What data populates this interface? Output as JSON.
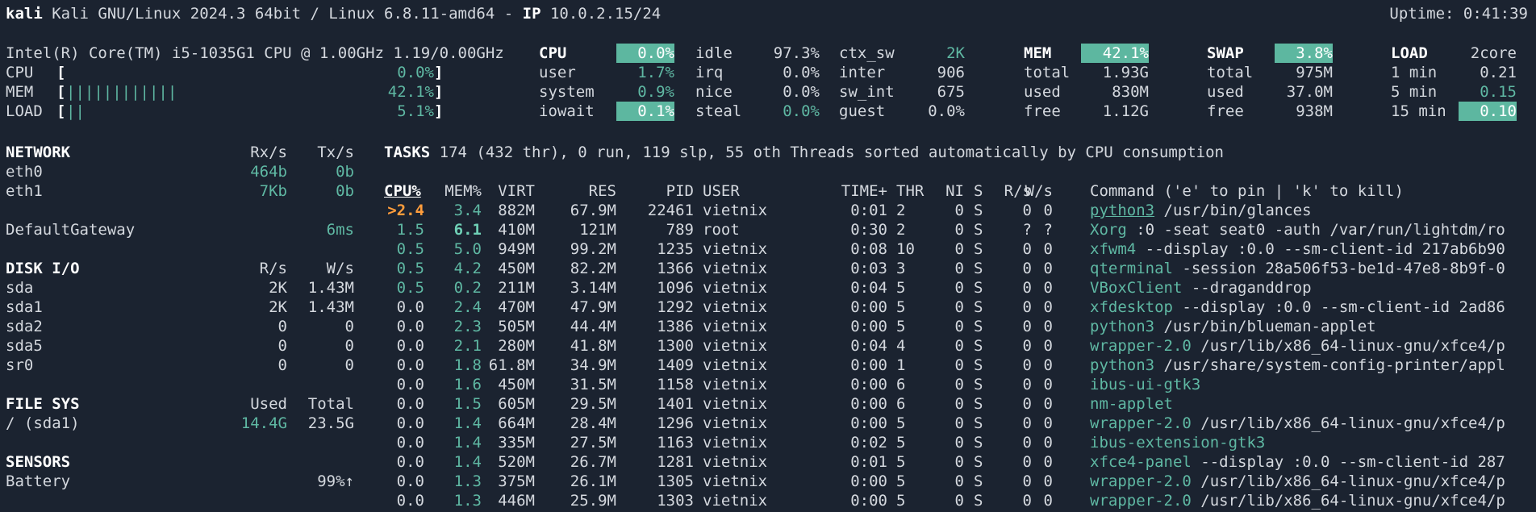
{
  "header": {
    "hostname": "kali",
    "os": "Kali GNU/Linux 2024.3 64bit / Linux 6.8.11-amd64 -",
    "ip_label": "IP",
    "ip": "10.0.2.15/24",
    "uptime": "Uptime: 0:41:39"
  },
  "quicklook": {
    "cpu_name": "Intel(R) Core(TM) i5-1035G1 CPU @ 1.00GHz 1.19/0.00GHz",
    "rows": [
      {
        "label": "CPU",
        "open": "[",
        "bar": "",
        "value": "0.0%",
        "close": "]"
      },
      {
        "label": "MEM",
        "open": "[",
        "bar": "||||||||||||",
        "value": "42.1%",
        "close": "]"
      },
      {
        "label": "LOAD",
        "open": "[",
        "bar": "||",
        "value": "5.1%",
        "close": "]"
      }
    ]
  },
  "cpu": {
    "title": "CPU",
    "total": "0.0%",
    "col1": [
      {
        "k": "user",
        "v": "1.7%"
      },
      {
        "k": "system",
        "v": "0.9%"
      },
      {
        "k": "iowait",
        "v": "0.1%"
      }
    ],
    "col2": [
      {
        "k": "idle",
        "v": "97.3%"
      },
      {
        "k": "irq",
        "v": "0.0%"
      },
      {
        "k": "nice",
        "v": "0.0%"
      },
      {
        "k": "steal",
        "v": "0.0%"
      }
    ],
    "col3": [
      {
        "k": "ctx_sw",
        "v": "2K"
      },
      {
        "k": "inter",
        "v": "906"
      },
      {
        "k": "sw_int",
        "v": "675"
      },
      {
        "k": "guest",
        "v": "0.0%"
      }
    ]
  },
  "mem": {
    "title": "MEM",
    "percent": "42.1%",
    "rows": [
      {
        "k": "total",
        "v": "1.93G"
      },
      {
        "k": "used",
        "v": "830M"
      },
      {
        "k": "free",
        "v": "1.12G"
      }
    ]
  },
  "swap": {
    "title": "SWAP",
    "percent": "3.8%",
    "rows": [
      {
        "k": "total",
        "v": "975M"
      },
      {
        "k": "used",
        "v": "37.0M"
      },
      {
        "k": "free",
        "v": "938M"
      }
    ]
  },
  "load": {
    "title": "LOAD",
    "cores": "2core",
    "rows": [
      {
        "k": "1 min",
        "v": "0.21"
      },
      {
        "k": "5 min",
        "v": "0.15"
      },
      {
        "k": "15 min",
        "v": "0.10"
      }
    ]
  },
  "network": {
    "title": "NETWORK",
    "rx": "Rx/s",
    "tx": "Tx/s",
    "rows": [
      {
        "name": "eth0",
        "rx": "464b",
        "tx": "0b"
      },
      {
        "name": "eth1",
        "rx": "7Kb",
        "tx": "0b"
      }
    ],
    "gateway_label": "DefaultGateway",
    "gateway_value": "6ms"
  },
  "disk": {
    "title": "DISK I/O",
    "r": "R/s",
    "w": "W/s",
    "rows": [
      {
        "name": "sda",
        "r": "2K",
        "w": "1.43M"
      },
      {
        "name": "sda1",
        "r": "2K",
        "w": "1.43M"
      },
      {
        "name": "sda2",
        "r": "0",
        "w": "0"
      },
      {
        "name": "sda5",
        "r": "0",
        "w": "0"
      },
      {
        "name": "sr0",
        "r": "0",
        "w": "0"
      }
    ]
  },
  "fs": {
    "title": "FILE SYS",
    "used": "Used",
    "total": "Total",
    "rows": [
      {
        "name": "/ (sda1)",
        "used": "14.4G",
        "total": "23.5G"
      }
    ]
  },
  "sensors": {
    "title": "SENSORS",
    "rows": [
      {
        "name": "Battery",
        "value": "99%↑"
      }
    ]
  },
  "tasks": {
    "title": "TASKS",
    "summary": "174 (432 thr), 0 run, 119 slp, 55 oth Threads sorted automatically by CPU consumption"
  },
  "proc_headers": {
    "cpu": "CPU%",
    "mem": "MEM%",
    "virt": "VIRT",
    "res": "RES",
    "pid": "PID",
    "user": "USER",
    "time": "TIME+",
    "thr": "THR",
    "ni": "NI",
    "s": "S",
    "rs": "R/s",
    "ws": "W/s",
    "cmd": "Command ('e' to pin | 'k' to kill)"
  },
  "processes": [
    {
      "cpu": ">2.4",
      "mem": "3.4",
      "virt": "882M",
      "res": "67.9M",
      "pid": "22461",
      "user": "vietnix",
      "time": "0:01",
      "thr": "2",
      "ni": "0",
      "s": "S",
      "rs": "0",
      "ws": "0",
      "prog": "python3",
      "args": " /usr/bin/glances"
    },
    {
      "cpu": "1.5",
      "mem": "6.1",
      "virt": "410M",
      "res": "121M",
      "pid": "789",
      "user": "root",
      "time": "0:30",
      "thr": "2",
      "ni": "0",
      "s": "S",
      "rs": "?",
      "ws": "?",
      "prog": "Xorg",
      "args": " :0 -seat seat0 -auth /var/run/lightdm/ro"
    },
    {
      "cpu": "0.5",
      "mem": "5.0",
      "virt": "949M",
      "res": "99.2M",
      "pid": "1235",
      "user": "vietnix",
      "time": "0:08",
      "thr": "10",
      "ni": "0",
      "s": "S",
      "rs": "0",
      "ws": "0",
      "prog": "xfwm4",
      "args": " --display :0.0 --sm-client-id 217ab6b90"
    },
    {
      "cpu": "0.5",
      "mem": "4.2",
      "virt": "450M",
      "res": "82.2M",
      "pid": "1366",
      "user": "vietnix",
      "time": "0:03",
      "thr": "3",
      "ni": "0",
      "s": "S",
      "rs": "0",
      "ws": "0",
      "prog": "qterminal",
      "args": " -session 28a506f53-be1d-47e8-8b9f-0"
    },
    {
      "cpu": "0.5",
      "mem": "0.2",
      "virt": "211M",
      "res": "3.14M",
      "pid": "1096",
      "user": "vietnix",
      "time": "0:04",
      "thr": "5",
      "ni": "0",
      "s": "S",
      "rs": "0",
      "ws": "0",
      "prog": "VBoxClient",
      "args": " --draganddrop"
    },
    {
      "cpu": "0.0",
      "mem": "2.4",
      "virt": "470M",
      "res": "47.9M",
      "pid": "1292",
      "user": "vietnix",
      "time": "0:00",
      "thr": "5",
      "ni": "0",
      "s": "S",
      "rs": "0",
      "ws": "0",
      "prog": "xfdesktop",
      "args": " --display :0.0 --sm-client-id 2ad86"
    },
    {
      "cpu": "0.0",
      "mem": "2.3",
      "virt": "505M",
      "res": "44.4M",
      "pid": "1386",
      "user": "vietnix",
      "time": "0:00",
      "thr": "5",
      "ni": "0",
      "s": "S",
      "rs": "0",
      "ws": "0",
      "prog": "python3",
      "args": " /usr/bin/blueman-applet"
    },
    {
      "cpu": "0.0",
      "mem": "2.1",
      "virt": "280M",
      "res": "41.8M",
      "pid": "1300",
      "user": "vietnix",
      "time": "0:04",
      "thr": "4",
      "ni": "0",
      "s": "S",
      "rs": "0",
      "ws": "0",
      "prog": "wrapper-2.0",
      "args": " /usr/lib/x86_64-linux-gnu/xfce4/p"
    },
    {
      "cpu": "0.0",
      "mem": "1.8",
      "virt": "61.8M",
      "res": "34.9M",
      "pid": "1409",
      "user": "vietnix",
      "time": "0:00",
      "thr": "1",
      "ni": "0",
      "s": "S",
      "rs": "0",
      "ws": "0",
      "prog": "python3",
      "args": " /usr/share/system-config-printer/appl"
    },
    {
      "cpu": "0.0",
      "mem": "1.6",
      "virt": "450M",
      "res": "31.5M",
      "pid": "1158",
      "user": "vietnix",
      "time": "0:00",
      "thr": "6",
      "ni": "0",
      "s": "S",
      "rs": "0",
      "ws": "0",
      "prog": "ibus-ui-gtk3",
      "args": ""
    },
    {
      "cpu": "0.0",
      "mem": "1.5",
      "virt": "605M",
      "res": "29.5M",
      "pid": "1401",
      "user": "vietnix",
      "time": "0:00",
      "thr": "6",
      "ni": "0",
      "s": "S",
      "rs": "0",
      "ws": "0",
      "prog": "nm-applet",
      "args": ""
    },
    {
      "cpu": "0.0",
      "mem": "1.4",
      "virt": "664M",
      "res": "28.4M",
      "pid": "1296",
      "user": "vietnix",
      "time": "0:00",
      "thr": "5",
      "ni": "0",
      "s": "S",
      "rs": "0",
      "ws": "0",
      "prog": "wrapper-2.0",
      "args": " /usr/lib/x86_64-linux-gnu/xfce4/p"
    },
    {
      "cpu": "0.0",
      "mem": "1.4",
      "virt": "335M",
      "res": "27.5M",
      "pid": "1163",
      "user": "vietnix",
      "time": "0:02",
      "thr": "5",
      "ni": "0",
      "s": "S",
      "rs": "0",
      "ws": "0",
      "prog": "ibus-extension-gtk3",
      "args": ""
    },
    {
      "cpu": "0.0",
      "mem": "1.4",
      "virt": "520M",
      "res": "26.7M",
      "pid": "1281",
      "user": "vietnix",
      "time": "0:01",
      "thr": "5",
      "ni": "0",
      "s": "S",
      "rs": "0",
      "ws": "0",
      "prog": "xfce4-panel",
      "args": " --display :0.0 --sm-client-id 287"
    },
    {
      "cpu": "0.0",
      "mem": "1.3",
      "virt": "375M",
      "res": "26.1M",
      "pid": "1305",
      "user": "vietnix",
      "time": "0:00",
      "thr": "5",
      "ni": "0",
      "s": "S",
      "rs": "0",
      "ws": "0",
      "prog": "wrapper-2.0",
      "args": " /usr/lib/x86_64-linux-gnu/xfce4/p"
    },
    {
      "cpu": "0.0",
      "mem": "1.3",
      "virt": "446M",
      "res": "25.9M",
      "pid": "1303",
      "user": "vietnix",
      "time": "0:00",
      "thr": "5",
      "ni": "0",
      "s": "S",
      "rs": "0",
      "ws": "0",
      "prog": "wrapper-2.0",
      "args": " /usr/lib/x86_64-linux-gnu/xfce4/p"
    }
  ],
  "colors": {
    "background": "#1b2330",
    "text": "#d4d8de",
    "accent": "#5fb8a3",
    "highlight": "#5db7a0",
    "warning": "#ff9d3c"
  }
}
